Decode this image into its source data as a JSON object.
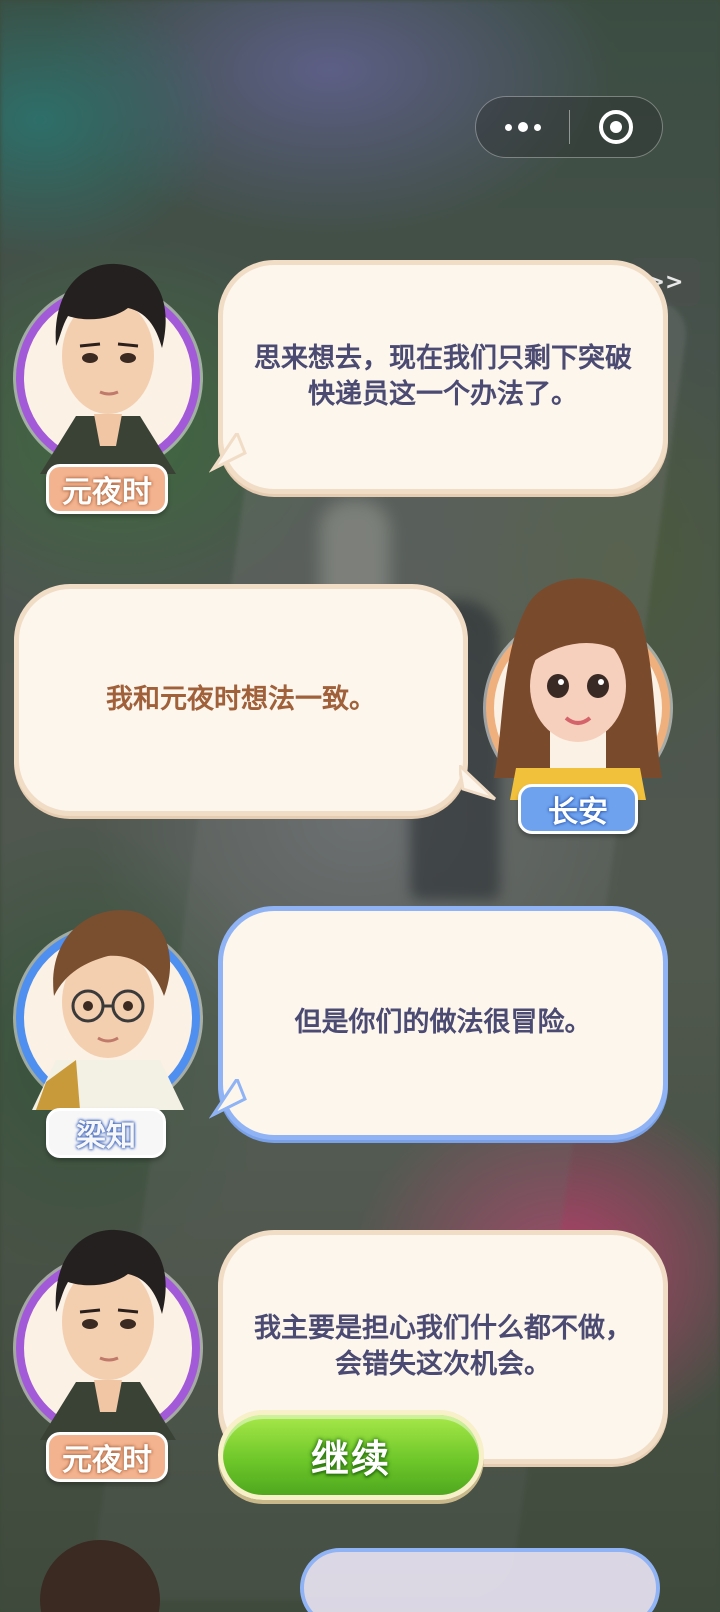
{
  "capsule": {
    "more_icon": "more-dots-icon",
    "close_icon": "target-close-icon"
  },
  "skip": {
    "label": ">>"
  },
  "dialogue": [
    {
      "speaker": "元夜时",
      "text": "思来想去，现在我们只剩下突破快递员这一个办法了。",
      "side": "left",
      "frame_color": "#a35ad9"
    },
    {
      "speaker": "长安",
      "text": "我和元夜时想法一致。",
      "side": "right",
      "frame_color": "#efb07d"
    },
    {
      "speaker": "梁知",
      "text": "但是你们的做法很冒险。",
      "side": "left",
      "frame_color": "#4f8ff0"
    },
    {
      "speaker": "元夜时",
      "text": "我主要是担心我们什么都不做，会错失这次机会。",
      "side": "left",
      "frame_color": "#a35ad9"
    }
  ],
  "continue_button": {
    "label": "继续"
  },
  "colors": {
    "bubble_bg": "#fdf6ec",
    "accent_green": "#6fc82a",
    "text_dark": "#4a4a72",
    "text_warm": "#a0603a"
  }
}
